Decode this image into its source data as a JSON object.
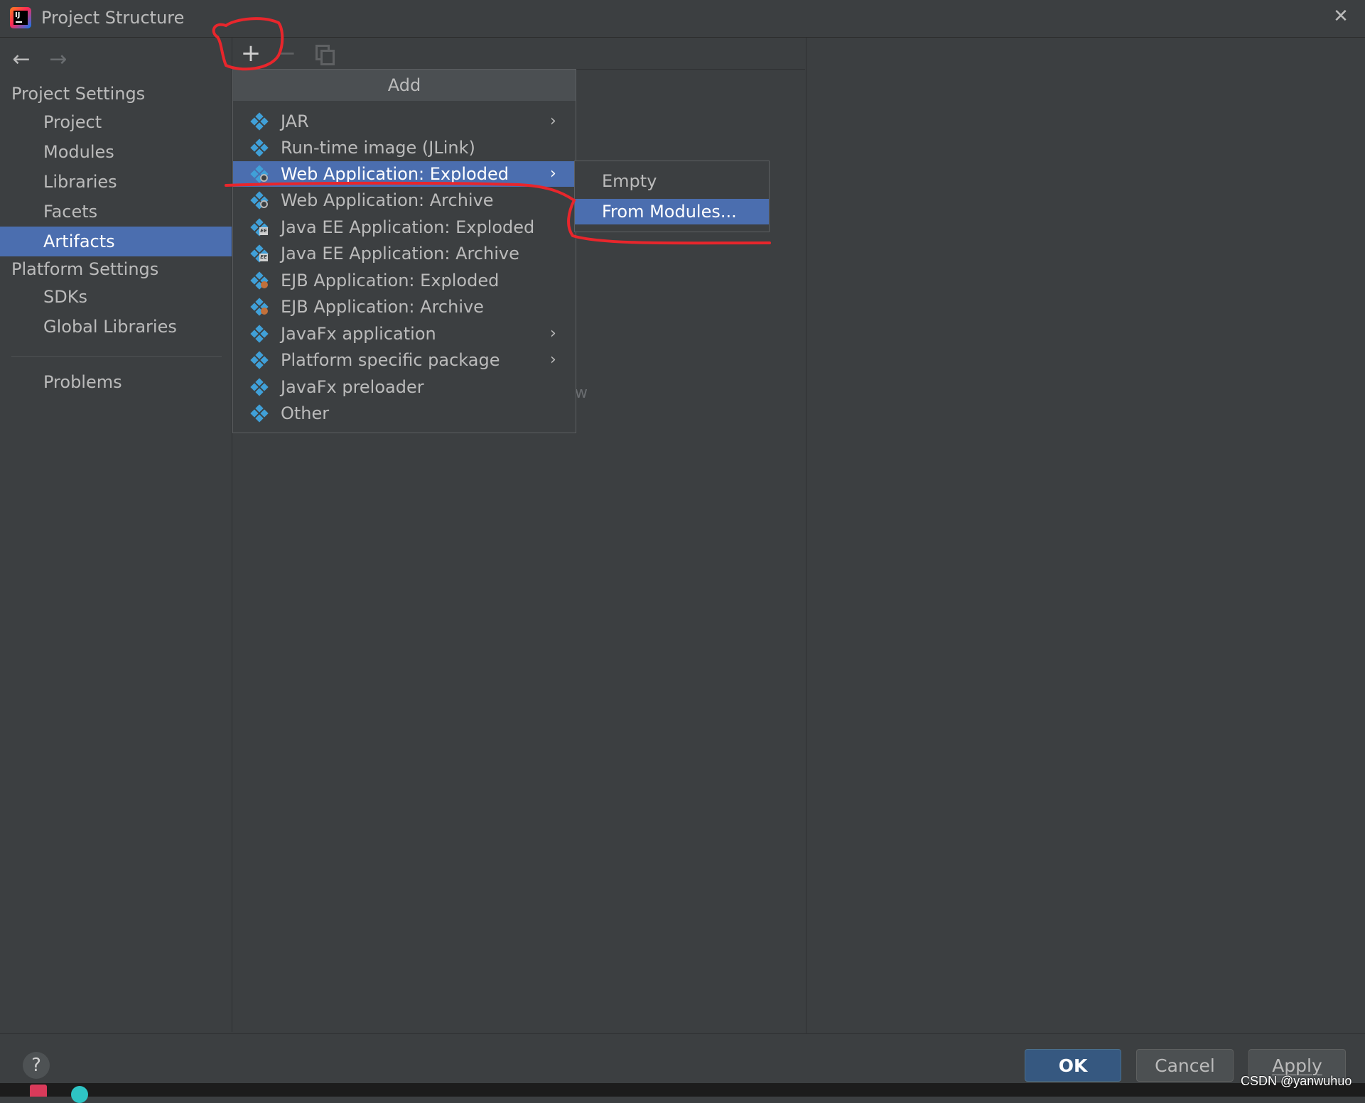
{
  "window": {
    "title": "Project Structure",
    "app_icon_label": "IJ",
    "close_glyph": "✕"
  },
  "nav": {
    "back_glyph": "←",
    "forward_glyph": "→"
  },
  "sidebar": {
    "project_settings_header": "Project Settings",
    "project_settings_items": [
      {
        "label": "Project",
        "selected": false
      },
      {
        "label": "Modules",
        "selected": false
      },
      {
        "label": "Libraries",
        "selected": false
      },
      {
        "label": "Facets",
        "selected": false
      },
      {
        "label": "Artifacts",
        "selected": true
      }
    ],
    "platform_settings_header": "Platform Settings",
    "platform_settings_items": [
      {
        "label": "SDKs"
      },
      {
        "label": "Global Libraries"
      }
    ],
    "problems_label": "Problems"
  },
  "toolbar": {
    "add_glyph": "+",
    "remove_glyph": "−"
  },
  "center": {
    "hint_fragment": "w"
  },
  "add_menu": {
    "header": "Add",
    "items": [
      {
        "label": "JAR",
        "icon": "artifact-icon",
        "has_submenu": true
      },
      {
        "label": "Run-time image (JLink)",
        "icon": "artifact-icon",
        "has_submenu": false
      },
      {
        "label": "Web Application: Exploded",
        "icon": "web-artifact-icon",
        "has_submenu": true,
        "highlighted": true
      },
      {
        "label": "Web Application: Archive",
        "icon": "web-artifact-icon",
        "has_submenu": false
      },
      {
        "label": "Java EE Application: Exploded",
        "icon": "javaee-artifact-icon",
        "has_submenu": false
      },
      {
        "label": "Java EE Application: Archive",
        "icon": "javaee-artifact-icon",
        "has_submenu": false
      },
      {
        "label": "EJB Application: Exploded",
        "icon": "ejb-artifact-icon",
        "has_submenu": false
      },
      {
        "label": "EJB Application: Archive",
        "icon": "ejb-artifact-icon",
        "has_submenu": false
      },
      {
        "label": "JavaFx application",
        "icon": "artifact-icon",
        "has_submenu": true
      },
      {
        "label": "Platform specific package",
        "icon": "artifact-icon",
        "has_submenu": true
      },
      {
        "label": "JavaFx preloader",
        "icon": "artifact-icon",
        "has_submenu": false
      },
      {
        "label": "Other",
        "icon": "artifact-icon",
        "has_submenu": false
      }
    ],
    "submenu_arrow": "›"
  },
  "submenu": {
    "items": [
      {
        "label": "Empty",
        "highlighted": false
      },
      {
        "label": "From Modules...",
        "highlighted": true
      }
    ]
  },
  "footer": {
    "help_glyph": "?",
    "ok_label": "OK",
    "cancel_label": "Cancel",
    "apply_label": "Apply"
  },
  "watermark": "CSDN @yanwuhuo",
  "colors": {
    "background": "#3c3f41",
    "selection": "#4b6eaf",
    "ok_button": "#365880",
    "annotation": "#e8262c",
    "icon_blue": "#40a0d8"
  }
}
